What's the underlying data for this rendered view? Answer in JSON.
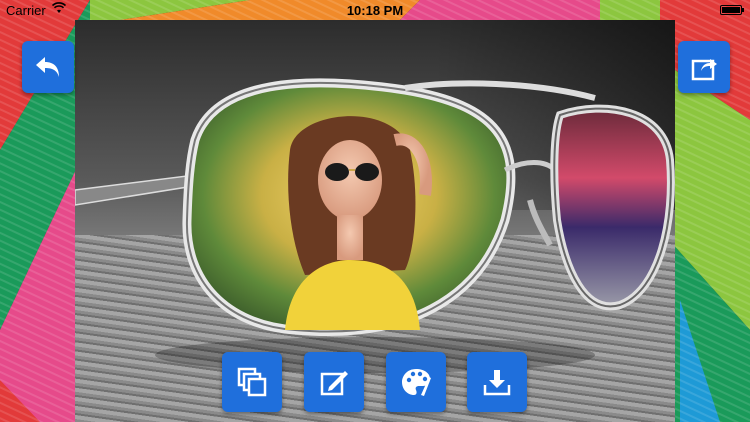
{
  "status_bar": {
    "carrier": "Carrier",
    "time": "10:18 PM"
  },
  "colors": {
    "button_blue": "#1f6fdc",
    "stripe_red": "#e23a3a",
    "stripe_green": "#1a9a5a",
    "stripe_pink": "#e64a8a",
    "stripe_orange": "#f08a2a",
    "stripe_lime": "#8cc63f",
    "stripe_blue": "#1e9ad6"
  },
  "icons": {
    "back": "back-arrow-icon",
    "share": "share-icon",
    "frames": "layers-icon",
    "edit": "edit-icon",
    "colors": "palette-icon",
    "save": "download-icon"
  }
}
